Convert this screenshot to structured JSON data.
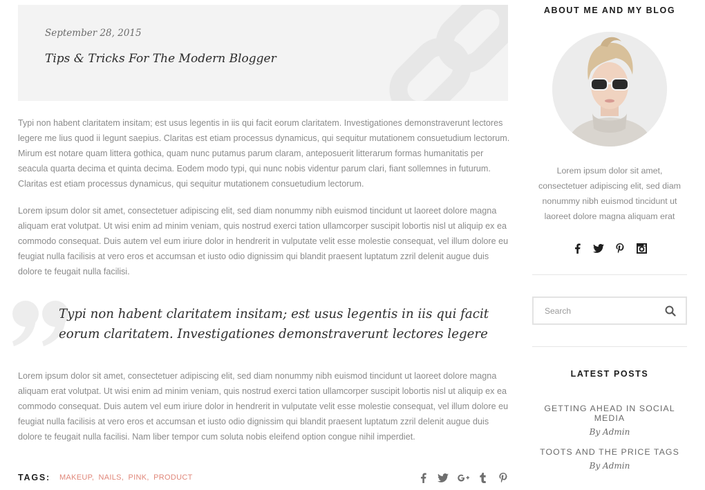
{
  "post": {
    "date": "September 28, 2015",
    "title": "Tips & Tricks For The Modern Blogger",
    "banner_icon": "link-icon",
    "paragraphs": [
      "Typi non habent claritatem insitam; est usus legentis in iis qui facit eorum claritatem. Investigationes demonstraverunt lectores legere me lius quod ii legunt saepius. Claritas est etiam processus dynamicus, qui sequitur mutationem consuetudium lectorum. Mirum est notare quam littera gothica, quam nunc putamus parum claram, anteposuerit litterarum formas humanitatis per seacula quarta decima et quinta decima. Eodem modo typi, qui nunc nobis videntur parum clari, fiant sollemnes in futurum. Claritas est etiam processus dynamicus, qui sequitur mutationem consuetudium lectorum.",
      "Lorem ipsum dolor sit amet, consectetuer adipiscing elit, sed diam nonummy nibh euismod tincidunt ut laoreet dolore magna aliquam erat volutpat. Ut wisi enim ad minim veniam, quis nostrud exerci tation ullamcorper suscipit lobortis nisl ut aliquip ex ea commodo consequat. Duis autem vel eum iriure dolor in hendrerit in vulputate velit esse molestie consequat, vel illum dolore eu feugiat nulla facilisis at vero eros et accumsan et iusto odio dignissim qui blandit praesent luptatum zzril delenit augue duis dolore te feugait nulla facilisi.",
      "Lorem ipsum dolor sit amet, consectetuer adipiscing elit, sed diam nonummy nibh euismod tincidunt ut laoreet dolore magna aliquam erat volutpat. Ut wisi enim ad minim veniam, quis nostrud exerci tation ullamcorper suscipit lobortis nisl ut aliquip ex ea commodo consequat. Duis autem vel eum iriure dolor in hendrerit in vulputate velit esse molestie consequat, vel illum dolore eu feugiat nulla facilisis at vero eros et accumsan et iusto odio dignissim qui blandit praesent luptatum zzril delenit augue duis dolore te feugait nulla facilisi. Nam liber tempor cum soluta nobis eleifend option congue nihil imperdiet."
    ],
    "quote": "Typi non habent claritatem insitam; est usus legentis in iis qui facit eorum claritatem. Investigationes demonstraverunt lectores legere",
    "tags_label": "TAGS:",
    "tags": [
      "MAKEUP",
      "NAILS",
      "PINK",
      "PRODUCT"
    ],
    "share_icons": [
      "facebook-icon",
      "twitter-icon",
      "google-plus-icon",
      "tumblr-icon",
      "pinterest-icon"
    ]
  },
  "sidebar": {
    "about_title": "ABOUT ME AND MY BLOG",
    "about_text": "Lorem ipsum dolor sit amet, consectetuer adipiscing elit, sed diam nonummy nibh euismod tincidunt ut laoreet dolore magna aliquam erat",
    "social_icons": [
      "facebook-icon",
      "twitter-icon",
      "pinterest-icon",
      "instagram-icon"
    ],
    "search": {
      "placeholder": "Search",
      "value": ""
    },
    "latest_title": "LATEST POSTS",
    "latest_posts": [
      {
        "title": "GETTING AHEAD IN SOCIAL MEDIA",
        "byline": "By Admin"
      },
      {
        "title": "TOOTS AND THE PRICE TAGS",
        "byline": "By Admin"
      }
    ]
  },
  "colors": {
    "accent": "#e0877a",
    "banner_bg": "#f3f3f3",
    "body_text": "#8b8b8b",
    "heading_text": "#1c1c1c"
  }
}
